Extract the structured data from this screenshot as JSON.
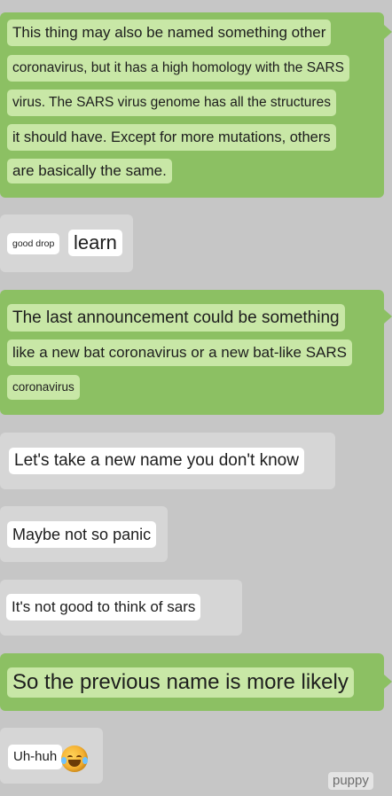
{
  "messages": [
    {
      "direction": "out",
      "lines": [
        "This thing may also be named something other",
        "coronavirus, but it has a high homology with the SARS",
        "virus. The SARS virus genome has all the structures",
        "it should have. Except for more mutations, others",
        "are basically the same."
      ]
    },
    {
      "direction": "in",
      "lines": [
        "good drop",
        "learn"
      ]
    },
    {
      "direction": "out",
      "lines": [
        "The last announcement could be something",
        "like a new bat coronavirus or a new bat-like SARS",
        "coronavirus"
      ]
    },
    {
      "direction": "in",
      "lines": [
        "Let's take a new name you don't know"
      ]
    },
    {
      "direction": "in",
      "lines": [
        "Maybe not so panic"
      ]
    },
    {
      "direction": "in",
      "lines": [
        "It's not good to think of sars"
      ]
    },
    {
      "direction": "out",
      "lines": [
        "So the previous name is more likely"
      ]
    },
    {
      "direction": "in",
      "lines": [
        "Uh-huh"
      ],
      "emoji": "laughing-crying-emoji-icon"
    }
  ],
  "watermark": "puppy",
  "colors": {
    "background": "#c6c6c6",
    "outgoing_bubble": "#8cc063",
    "outgoing_highlight": "#c8e7a6",
    "incoming_bubble": "#d6d6d6",
    "incoming_highlight": "#ffffff"
  }
}
